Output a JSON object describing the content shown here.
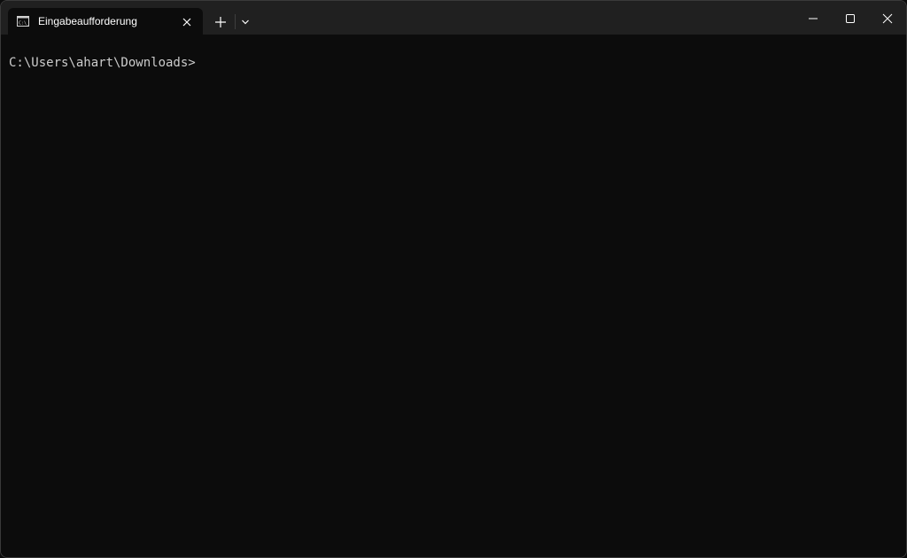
{
  "window": {
    "tab_title": "Eingabeaufforderung",
    "tab_icon": "command-prompt-icon",
    "new_tab_icon": "plus-icon",
    "dropdown_icon": "chevron-down-icon",
    "controls": [
      "minimize-icon",
      "maximize-icon",
      "close-icon"
    ]
  },
  "terminal": {
    "prompt": "C:\\Users\\ahart\\Downloads>"
  },
  "colors": {
    "titlebar": "#202020",
    "terminal_bg": "#0c0c0c",
    "terminal_text": "#cccccc",
    "tab_text": "#ffffff"
  }
}
